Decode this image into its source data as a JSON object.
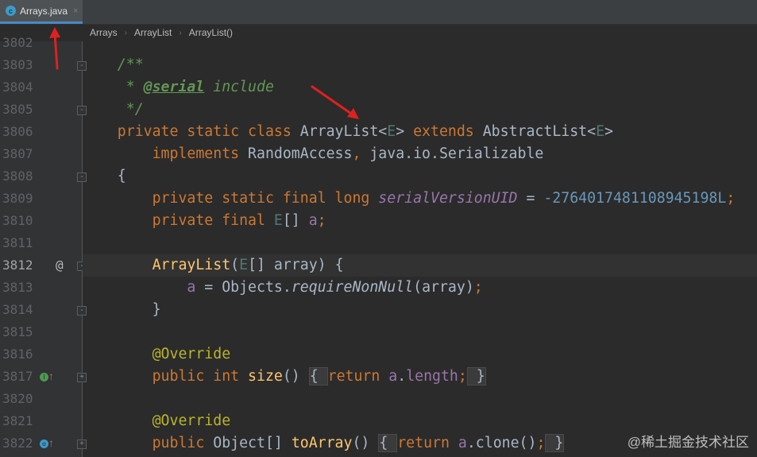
{
  "tab": {
    "label": "Arrays.java",
    "icon": "java-class-icon",
    "close": "×"
  },
  "breadcrumb": [
    "Arrays",
    "ArrayList",
    "ArrayList()"
  ],
  "current_line": "3812",
  "lines": [
    {
      "n": "3802",
      "tokens": []
    },
    {
      "n": "3803",
      "fold": true,
      "tokens": [
        [
          "    /**",
          "c"
        ]
      ]
    },
    {
      "n": "3804",
      "tokens": [
        [
          "     * ",
          "c"
        ],
        [
          "@serial",
          "ct"
        ],
        [
          " include",
          "c"
        ]
      ]
    },
    {
      "n": "3805",
      "fold": true,
      "tokens": [
        [
          "     */",
          "c"
        ]
      ]
    },
    {
      "n": "3806",
      "tokens": [
        [
          "    private static class ",
          "k"
        ],
        [
          "ArrayList<",
          ""
        ],
        [
          "E",
          "t"
        ],
        [
          "> ",
          ""
        ],
        [
          "extends ",
          "k"
        ],
        [
          "AbstractList<",
          ""
        ],
        [
          "E",
          "t"
        ],
        [
          ">",
          ""
        ]
      ]
    },
    {
      "n": "3807",
      "tokens": [
        [
          "        implements ",
          "k"
        ],
        [
          "RandomAccess",
          ""
        ],
        [
          ", ",
          "k"
        ],
        [
          "java.io.Serializable",
          ""
        ]
      ]
    },
    {
      "n": "3808",
      "fold": true,
      "tokens": [
        [
          "    {",
          ""
        ]
      ]
    },
    {
      "n": "3809",
      "tokens": [
        [
          "        private static final long ",
          "k"
        ],
        [
          "serialVersionUID",
          "fi"
        ],
        [
          " = ",
          ""
        ],
        [
          "-2764017481108945198L",
          "n"
        ],
        [
          ";",
          "k"
        ]
      ]
    },
    {
      "n": "3810",
      "tokens": [
        [
          "        private final ",
          "k"
        ],
        [
          "E",
          "t"
        ],
        [
          "[] ",
          ""
        ],
        [
          "a",
          "f"
        ],
        [
          ";",
          "k"
        ]
      ]
    },
    {
      "n": "3811",
      "tokens": []
    },
    {
      "n": "3812",
      "fold": true,
      "marker": "@",
      "tokens": [
        [
          "        ",
          ""
        ],
        [
          "ArrayList",
          "mf"
        ],
        [
          "(",
          ""
        ],
        [
          "E",
          "t"
        ],
        [
          "[] array) {",
          ""
        ]
      ]
    },
    {
      "n": "3813",
      "tokens": [
        [
          "            ",
          ""
        ],
        [
          "a",
          "f"
        ],
        [
          " = Objects.",
          ""
        ],
        [
          "requireNonNull",
          "m"
        ],
        [
          "(array)",
          ""
        ],
        [
          ";",
          "k"
        ]
      ]
    },
    {
      "n": "3814",
      "fold": true,
      "tokens": [
        [
          "        }",
          ""
        ]
      ]
    },
    {
      "n": "3815",
      "tokens": []
    },
    {
      "n": "3816",
      "tokens": [
        [
          "        @Override",
          "a"
        ]
      ]
    },
    {
      "n": "3817",
      "fold": true,
      "gicon": "I",
      "giconColor": "#4e9a4e",
      "tokens": [
        [
          "        public int ",
          "k"
        ],
        [
          "size",
          "mf"
        ],
        [
          "() ",
          ""
        ],
        [
          "{ ",
          "fb"
        ],
        [
          "return ",
          "k"
        ],
        [
          "a",
          "f"
        ],
        [
          ".",
          ""
        ],
        [
          "length",
          "f"
        ],
        [
          ";",
          "k"
        ],
        [
          " }",
          "fb"
        ]
      ]
    },
    {
      "n": "3820",
      "tokens": []
    },
    {
      "n": "3821",
      "tokens": [
        [
          "        @Override",
          "a"
        ]
      ]
    },
    {
      "n": "3822",
      "fold": true,
      "gicon": "O",
      "giconColor": "#3d9ac7",
      "tokens": [
        [
          "        public ",
          "k"
        ],
        [
          "Object[] ",
          ""
        ],
        [
          "toArray",
          "mf"
        ],
        [
          "() ",
          ""
        ],
        [
          "{ ",
          "fb"
        ],
        [
          "return ",
          "k"
        ],
        [
          "a",
          "f"
        ],
        [
          ".clone()",
          ""
        ],
        [
          ";",
          "k"
        ],
        [
          " }",
          "fb"
        ]
      ]
    }
  ],
  "watermark": "@稀土掘金技术社区"
}
